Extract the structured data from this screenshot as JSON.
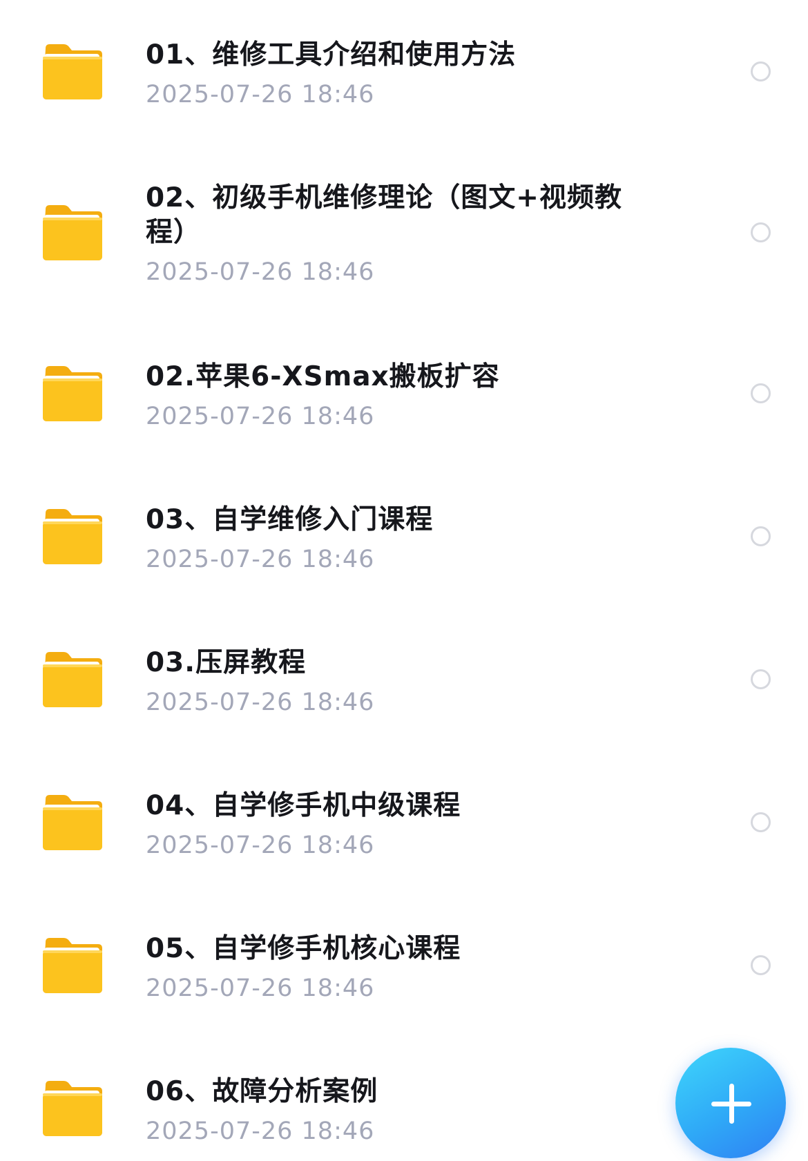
{
  "files": [
    {
      "name": "01、维修工具介绍和使用方法",
      "date": "2025-07-26 18:46",
      "icon": "folder-icon"
    },
    {
      "name": "02、初级手机维修理论（图文+视频教程）",
      "date": "2025-07-26 18:46",
      "icon": "folder-icon"
    },
    {
      "name": "02.苹果6-XSmax搬板扩容",
      "date": "2025-07-26 18:46",
      "icon": "folder-icon"
    },
    {
      "name": "03、自学维修入门课程",
      "date": "2025-07-26 18:46",
      "icon": "folder-icon"
    },
    {
      "name": "03.压屏教程",
      "date": "2025-07-26 18:46",
      "icon": "folder-icon"
    },
    {
      "name": "04、自学修手机中级课程",
      "date": "2025-07-26 18:46",
      "icon": "folder-icon"
    },
    {
      "name": "05、自学修手机核心课程",
      "date": "2025-07-26 18:46",
      "icon": "folder-icon"
    },
    {
      "name": "06、故障分析案例",
      "date": "2025-07-26 18:46",
      "icon": "folder-icon"
    }
  ],
  "fab": {
    "icon": "plus-icon"
  },
  "colors": {
    "folder": "#fcc31e",
    "title": "#16171c",
    "date": "#a3a7b8",
    "radio_border": "#d6d8de",
    "fab_accent": "#2fa9f7"
  }
}
